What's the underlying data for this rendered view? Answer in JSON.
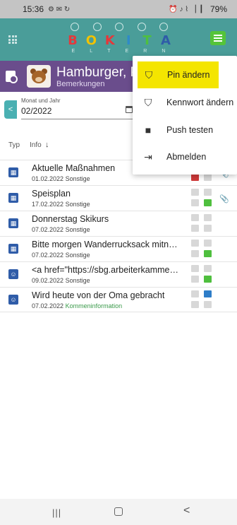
{
  "statusbar": {
    "time": "15:36",
    "battery": "79%",
    "left_icons": "⚙ ✉ ↻",
    "right_icons": "⏰ ♪ ⌇ ▕▕▏"
  },
  "logo": {
    "letters": [
      "B",
      "O",
      "K",
      "I",
      "T",
      "A"
    ],
    "subtitle": [
      "E",
      "L",
      "T",
      "E",
      "R",
      "N"
    ]
  },
  "child": {
    "name": "Hamburger, P",
    "subtitle": "Bemerkungen"
  },
  "filter": {
    "month_label": "Monat und Jahr",
    "month_value": "02/2022",
    "back_label": "<"
  },
  "columns": {
    "type": "Typ",
    "info": "Info",
    "sort_icon": "↓"
  },
  "menu": {
    "items": [
      {
        "label": "Pin ändern",
        "icon": "shield-person-icon",
        "glyph": "⛉",
        "active": true
      },
      {
        "label": "Kennwort ändern",
        "icon": "shield-lock-icon",
        "glyph": "⛉",
        "active": false
      },
      {
        "label": "Push testen",
        "icon": "message-icon",
        "glyph": "■",
        "active": false
      },
      {
        "label": "Abmelden",
        "icon": "logout-icon",
        "glyph": "⇥",
        "active": false
      }
    ]
  },
  "rows": [
    {
      "title": "Aktuelle Maßnahmen",
      "date": "01.02.2022",
      "category": "Sonstige",
      "type_icon": "building-icon",
      "type_glyph": "▦",
      "status": [
        "gray",
        "gray",
        "red",
        "gray"
      ],
      "attachment": true
    },
    {
      "title": "Speisplan",
      "date": "17.02.2022",
      "category": "Sonstige",
      "type_icon": "building-icon",
      "type_glyph": "▦",
      "status": [
        "gray",
        "gray",
        "gray",
        "green"
      ],
      "attachment": true
    },
    {
      "title": "Donnerstag Skikurs",
      "date": "07.02.2022",
      "category": "Sonstige",
      "type_icon": "building-icon",
      "type_glyph": "▦",
      "status": [
        "gray",
        "gray",
        "gray",
        "gray"
      ],
      "attachment": false
    },
    {
      "title": "Bitte morgen Wanderrucksack mitneh...",
      "date": "07.02.2022",
      "category": "Sonstige",
      "type_icon": "building-icon",
      "type_glyph": "▦",
      "status": [
        "gray",
        "gray",
        "gray",
        "green"
      ],
      "attachment": false
    },
    {
      "title": "<a href=\"https://sbg.arbeiterkammer....",
      "date": "09.02.2022",
      "category": "Sonstige",
      "type_icon": "person-icon",
      "type_glyph": "☺",
      "status": [
        "gray",
        "gray",
        "gray",
        "green"
      ],
      "attachment": false
    },
    {
      "title": "Wird heute von der Oma gebracht",
      "date": "07.02.2022",
      "category": "Kommeninformation",
      "type_icon": "person-icon",
      "type_glyph": "☺",
      "status": [
        "gray",
        "blue",
        "gray",
        "gray"
      ],
      "attachment": false
    }
  ],
  "nav": {
    "recent": "|||",
    "back": "<"
  }
}
